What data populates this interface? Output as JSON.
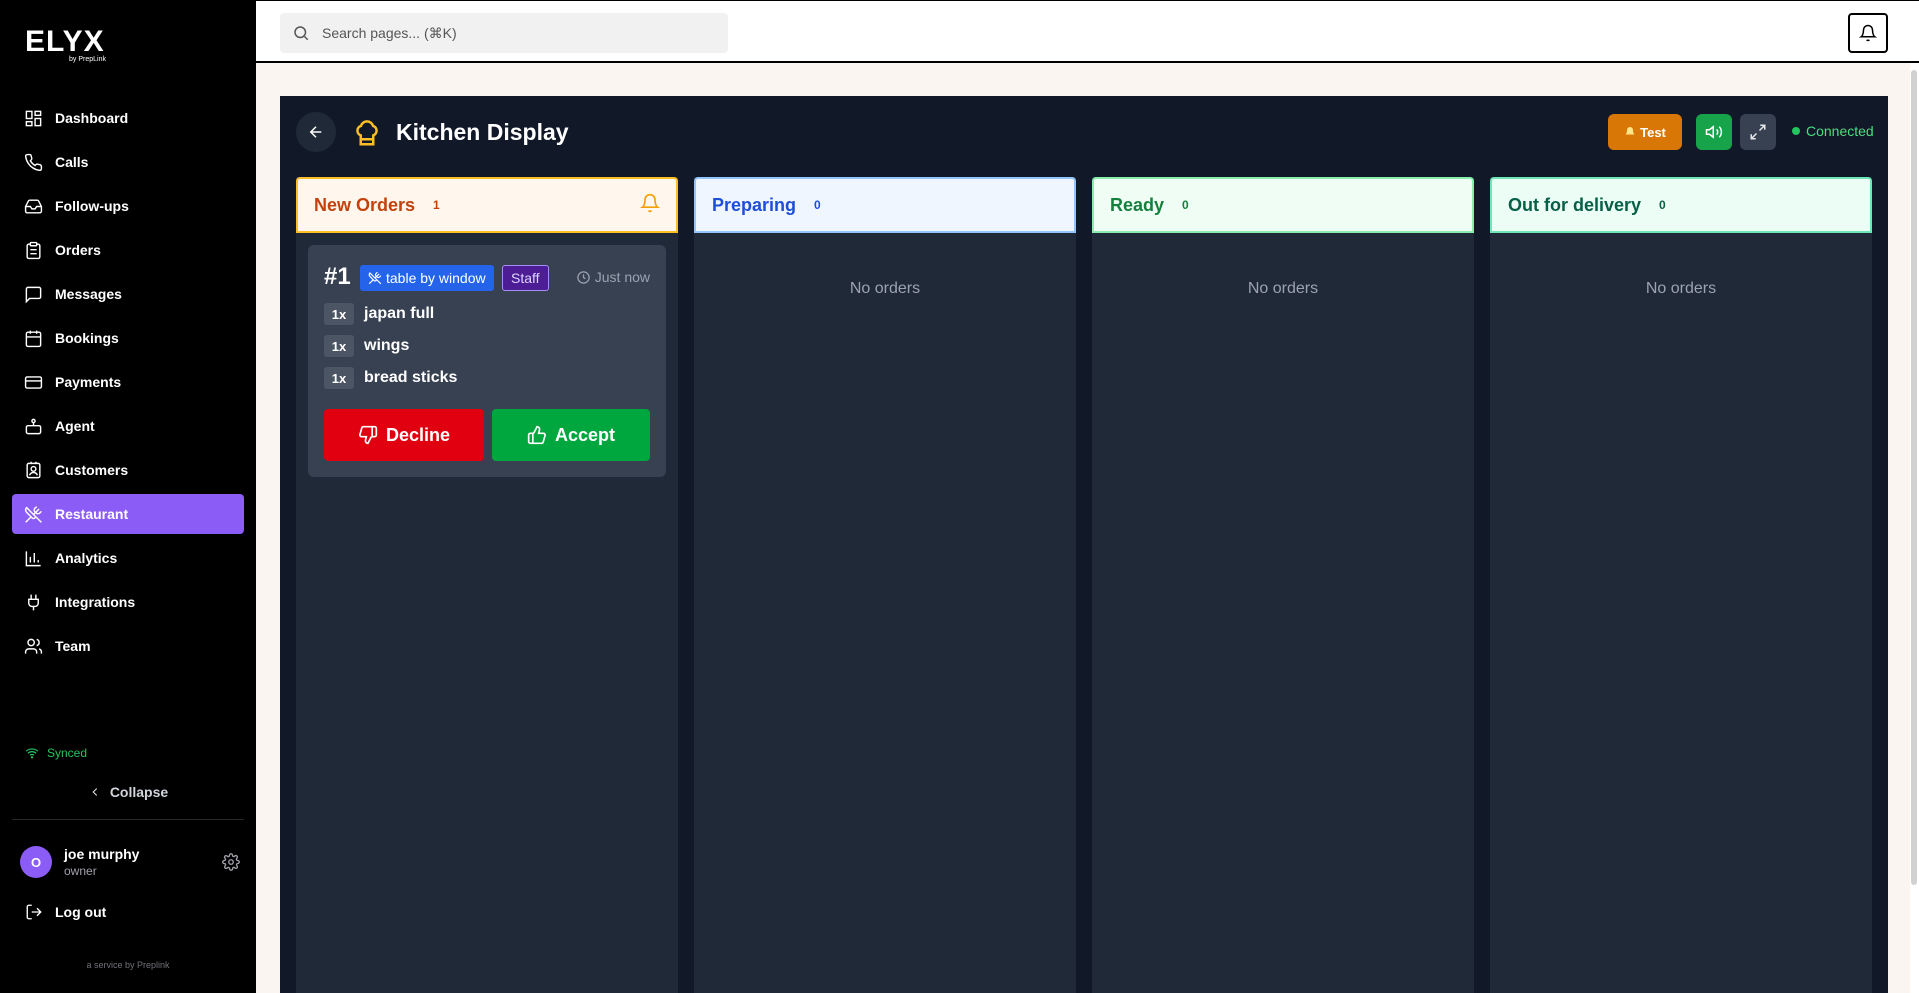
{
  "brand": {
    "logo": "ELYX",
    "sub": "by PrepLink"
  },
  "sidebar": {
    "items": [
      {
        "label": "Dashboard",
        "icon": "dashboard-icon"
      },
      {
        "label": "Calls",
        "icon": "phone-icon"
      },
      {
        "label": "Follow-ups",
        "icon": "inbox-icon"
      },
      {
        "label": "Orders",
        "icon": "clipboard-icon"
      },
      {
        "label": "Messages",
        "icon": "message-icon"
      },
      {
        "label": "Bookings",
        "icon": "calendar-icon"
      },
      {
        "label": "Payments",
        "icon": "credit-card-icon"
      },
      {
        "label": "Agent",
        "icon": "bot-icon"
      },
      {
        "label": "Customers",
        "icon": "contact-icon"
      },
      {
        "label": "Restaurant",
        "icon": "utensils-icon",
        "active": true
      },
      {
        "label": "Analytics",
        "icon": "bar-chart-icon"
      },
      {
        "label": "Integrations",
        "icon": "plug-icon"
      },
      {
        "label": "Team",
        "icon": "users-icon"
      }
    ],
    "synced": "Synced",
    "collapse": "Collapse",
    "user": {
      "initial": "O",
      "name": "joe murphy",
      "role": "owner"
    },
    "logout": "Log out",
    "footer": "a service by Preplink"
  },
  "header": {
    "search_placeholder": "Search pages... (⌘K)"
  },
  "kds": {
    "title": "Kitchen Display",
    "test_label": "Test",
    "status": "Connected",
    "columns": [
      {
        "title": "New Orders",
        "count": "1",
        "color": "#c2410c",
        "bg": "#fff7ed",
        "border": "#fbbf24"
      },
      {
        "title": "Preparing",
        "count": "0",
        "color": "#1d4ed8",
        "bg": "#eff6ff",
        "border": "#93c5fd",
        "empty": "No orders"
      },
      {
        "title": "Ready",
        "count": "0",
        "color": "#15803d",
        "bg": "#f0fdf4",
        "border": "#86efac",
        "empty": "No orders"
      },
      {
        "title": "Out for delivery",
        "count": "0",
        "color": "#065f46",
        "bg": "#ecfdf5",
        "border": "#6ee7b7",
        "empty": "No orders"
      }
    ],
    "order": {
      "number": "#1",
      "tag": "table by window",
      "source": "Staff",
      "time": "Just now",
      "items": [
        {
          "qty": "1x",
          "name": "japan full"
        },
        {
          "qty": "1x",
          "name": "wings"
        },
        {
          "qty": "1x",
          "name": "bread sticks"
        }
      ],
      "decline_label": "Decline",
      "accept_label": "Accept"
    }
  }
}
